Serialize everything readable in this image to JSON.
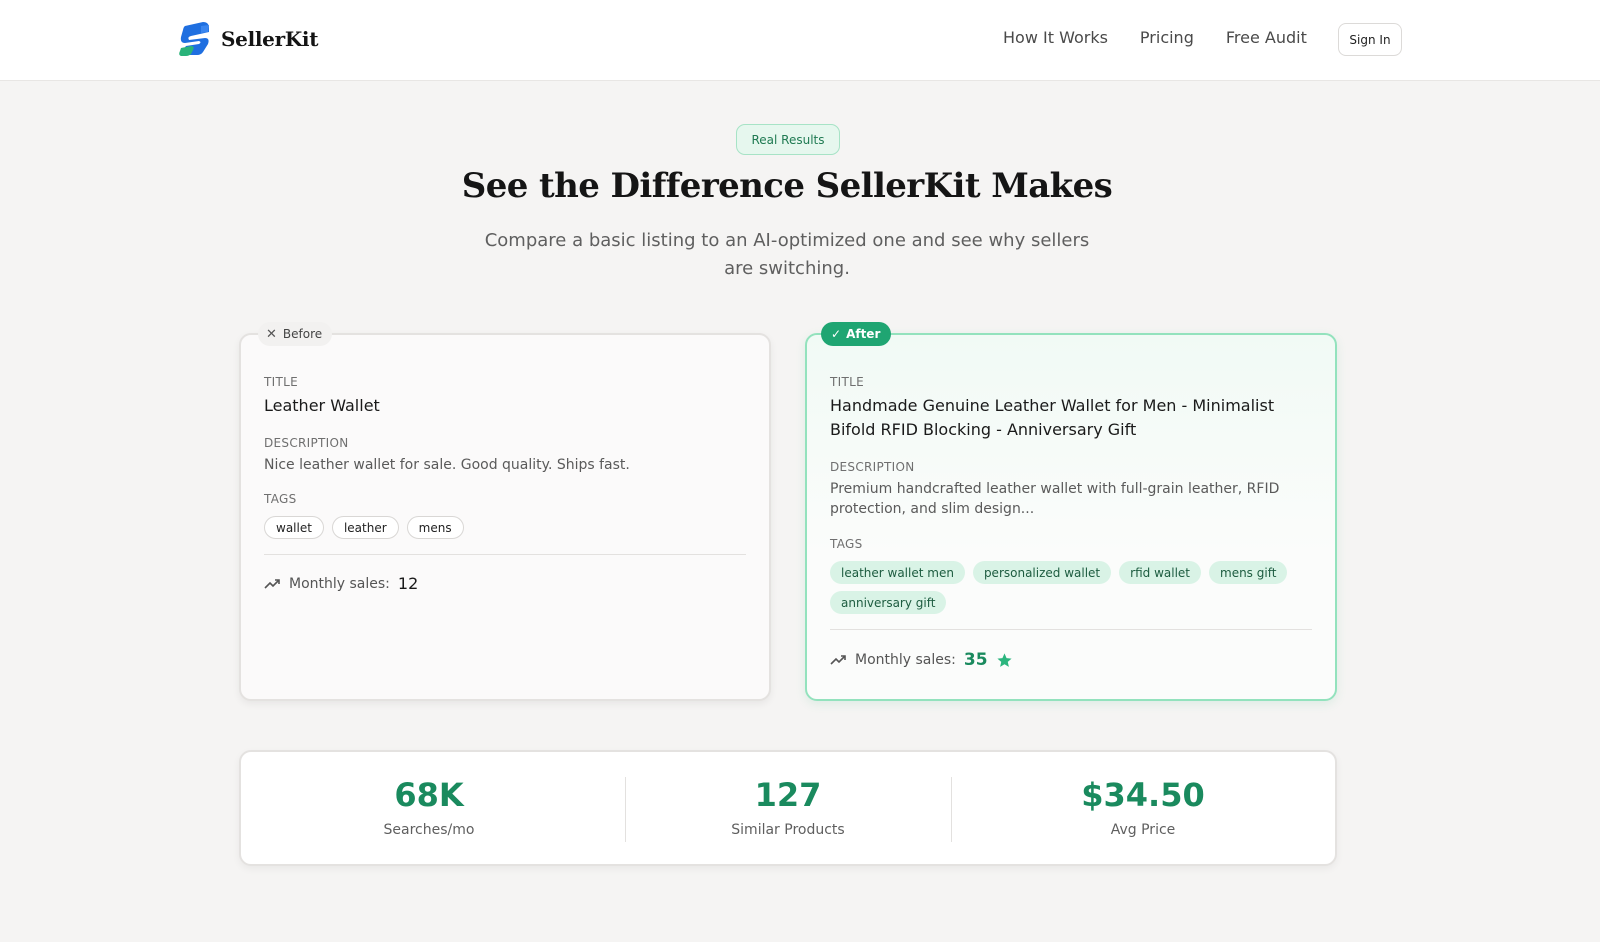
{
  "header": {
    "brand": "SellerKit",
    "nav": [
      "How It Works",
      "Pricing",
      "Free Audit"
    ],
    "signin_label": "Sign In"
  },
  "hero": {
    "badge": "Real Results",
    "title": "See the Difference SellerKit Makes",
    "subtitle": "Compare a basic listing to an AI-optimized one and see why sellers are switching."
  },
  "before": {
    "badge": "Before",
    "title_label": "TITLE",
    "title": "Leather Wallet",
    "desc_label": "DESCRIPTION",
    "description": "Nice leather wallet for sale. Good quality. Ships fast.",
    "tags_label": "TAGS",
    "tags": [
      "wallet",
      "leather",
      "mens"
    ],
    "sales_label": "Monthly sales:",
    "sales": "12"
  },
  "after": {
    "badge": "After",
    "title_label": "TITLE",
    "title": "Handmade Genuine Leather Wallet for Men - Minimalist Bifold RFID Blocking - Anniversary Gift",
    "desc_label": "DESCRIPTION",
    "description": "Premium handcrafted leather wallet with full-grain leather, RFID protection, and slim design...",
    "tags_label": "TAGS",
    "tags": [
      "leather wallet men",
      "personalized wallet",
      "rfid wallet",
      "mens gift",
      "anniversary gift"
    ],
    "sales_label": "Monthly sales:",
    "sales": "35"
  },
  "stats": [
    {
      "value": "68K",
      "label": "Searches/mo"
    },
    {
      "value": "127",
      "label": "Similar Products"
    },
    {
      "value": "$34.50",
      "label": "Avg Price"
    }
  ],
  "colors": {
    "accent": "#1fa572",
    "accent_text": "#1a8a5e",
    "background": "#f5f4f3"
  },
  "icons": {
    "logo": "sellerkit-logo-icon",
    "before": "close-icon",
    "after": "check-icon",
    "trend": "trending-up-icon",
    "star": "star-icon"
  }
}
